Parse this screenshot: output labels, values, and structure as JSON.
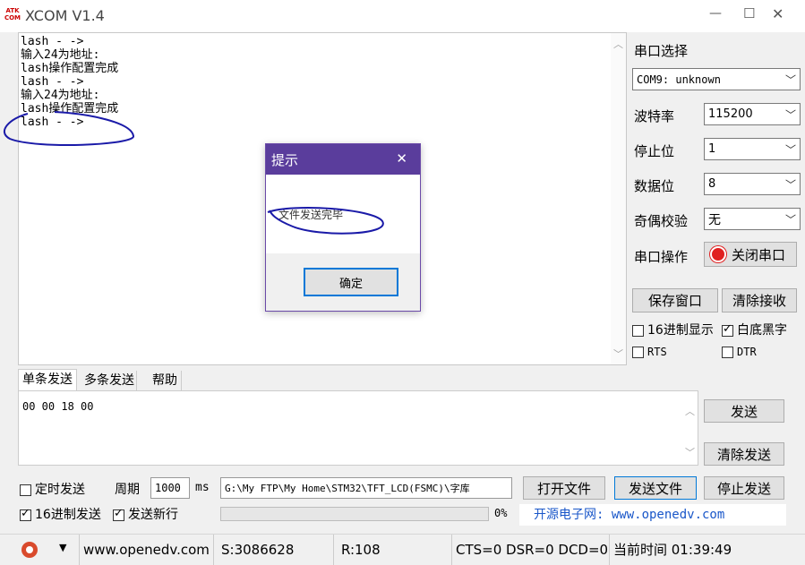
{
  "window": {
    "logo_text": "ATK COM",
    "title": "XCOM V1.4",
    "minimize": "—",
    "maximize": "☐",
    "close": "✕"
  },
  "receive_area": {
    "lines": [
      "lash - ->",
      "输入24为地址:",
      "lash操作配置完成",
      "lash - ->",
      "输入24为地址:",
      "lash操作配置完成",
      "lash - ->"
    ]
  },
  "dialog": {
    "title": "提示",
    "close": "✕",
    "message": "文件发送完毕",
    "ok_label": "确定"
  },
  "right_panel": {
    "port_select_label": "串口选择",
    "port_value": "COM9: unknown",
    "baud_label": "波特率",
    "baud_value": "115200",
    "stop_label": "停止位",
    "stop_value": "1",
    "data_label": "数据位",
    "data_value": "8",
    "parity_label": "奇偶校验",
    "parity_value": "无",
    "port_op_label": "串口操作",
    "close_port_label": "关闭串口",
    "save_window_label": "保存窗口",
    "clear_receive_label": "清除接收",
    "hex_display_label": "16进制显示",
    "white_black_label": "白底黑字",
    "rts_label": "RTS",
    "dtr_label": "DTR"
  },
  "tabs": [
    "单条发送",
    "多条发送",
    "帮助"
  ],
  "send_area": {
    "content": "00 00 18 00",
    "send_label": "发送",
    "clear_send_label": "清除发送"
  },
  "bottom": {
    "timed_send_label": "定时发送",
    "period_label": "周期",
    "period_value": "1000",
    "ms_label": "ms",
    "file_path": "G:\\My  FTP\\My Home\\STM32\\TFT_LCD(FSMC)\\字库",
    "open_file_label": "打开文件",
    "send_file_label": "发送文件",
    "stop_send_label": "停止发送",
    "hex_send_label": "16进制发送",
    "send_newline_label": "发送新行",
    "progress_percent": "0%",
    "website_text": "开源电子网: www.openedv.com"
  },
  "status_bar": {
    "url": "www.openedv.com",
    "sent": "S:3086628",
    "received": "R:108",
    "signals": "CTS=0 DSR=0 DCD=0",
    "time": "当前时间 01:39:49"
  }
}
